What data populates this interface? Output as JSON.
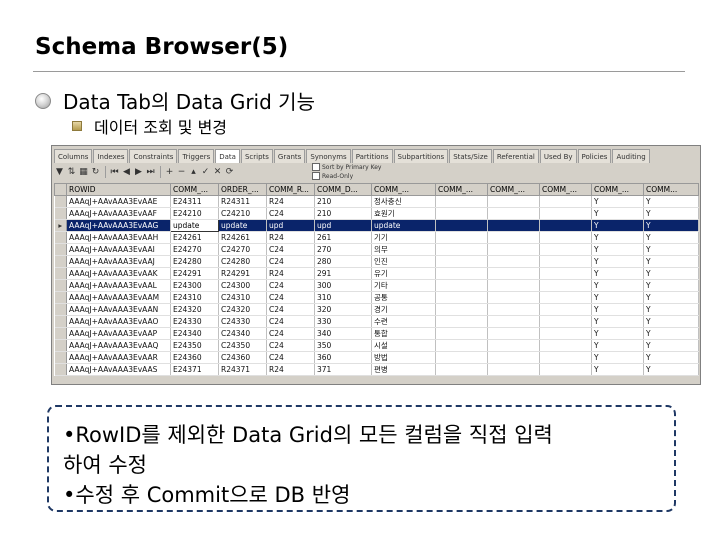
{
  "slide": {
    "title": "Schema Browser(5)",
    "bullet1": "Data Tab의 Data Grid 기능",
    "bullet2": "데이터 조회 및 변경"
  },
  "screenshot": {
    "tabs": [
      "Columns",
      "Indexes",
      "Constraints",
      "Triggers",
      "Data",
      "Scripts",
      "Grants",
      "Synonyms",
      "Partitions",
      "Subpartitions",
      "Stats/Size",
      "Referential",
      "Used By",
      "Policies",
      "Auditing"
    ],
    "active_tab": "Data",
    "toolbar_checks": [
      "Sort by Primary Key",
      "Read-Only"
    ],
    "columns": [
      "ROWID",
      "COMM_...",
      "ORDER_...",
      "COMM_R...",
      "COMM_D...",
      "COMM_...",
      "COMM_...",
      "COMM_...",
      "COMM_...",
      "COMM_...",
      "COMM..."
    ],
    "rows": [
      [
        "AAAqJ+AAvAAA3EvAAE",
        "E24311",
        "R24311",
        "R24",
        "210",
        "정사충신",
        "",
        "",
        "",
        "Y",
        "Y"
      ],
      [
        "AAAqJ+AAvAAA3EvAAF",
        "E24210",
        "C24210",
        "C24",
        "210",
        "효원기",
        "",
        "",
        "",
        "Y",
        "Y"
      ],
      [
        "AAAqJ+AAvAAA3EvAAG",
        "update",
        "update",
        "upd",
        "upd",
        "update",
        "",
        "",
        "",
        "Y",
        "Y"
      ],
      [
        "AAAqJ+AAvAAA3EvAAH",
        "E24261",
        "R24261",
        "R24",
        "261",
        "기기",
        "",
        "",
        "",
        "Y",
        "Y"
      ],
      [
        "AAAqJ+AAvAAA3EvAAI",
        "E24270",
        "C24270",
        "C24",
        "270",
        "의무",
        "",
        "",
        "",
        "Y",
        "Y"
      ],
      [
        "AAAqJ+AAvAAA3EvAAJ",
        "E24280",
        "C24280",
        "C24",
        "280",
        "인진",
        "",
        "",
        "",
        "Y",
        "Y"
      ],
      [
        "AAAqJ+AAvAAA3EvAAK",
        "E24291",
        "R24291",
        "R24",
        "291",
        "유기",
        "",
        "",
        "",
        "Y",
        "Y"
      ],
      [
        "AAAqJ+AAvAAA3EvAAL",
        "E24300",
        "C24300",
        "C24",
        "300",
        "기타",
        "",
        "",
        "",
        "Y",
        "Y"
      ],
      [
        "AAAqJ+AAvAAA3EvAAM",
        "E24310",
        "C24310",
        "C24",
        "310",
        "공통",
        "",
        "",
        "",
        "Y",
        "Y"
      ],
      [
        "AAAqJ+AAvAAA3EvAAN",
        "E24320",
        "C24320",
        "C24",
        "320",
        "경기",
        "",
        "",
        "",
        "Y",
        "Y"
      ],
      [
        "AAAqJ+AAvAAA3EvAAO",
        "E24330",
        "C24330",
        "C24",
        "330",
        "수련",
        "",
        "",
        "",
        "Y",
        "Y"
      ],
      [
        "AAAqJ+AAvAAA3EvAAP",
        "E24340",
        "C24340",
        "C24",
        "340",
        "통합",
        "",
        "",
        "",
        "Y",
        "Y"
      ],
      [
        "AAAqJ+AAvAAA3EvAAQ",
        "E24350",
        "C24350",
        "C24",
        "350",
        "시설",
        "",
        "",
        "",
        "Y",
        "Y"
      ],
      [
        "AAAqJ+AAvAAA3EvAAR",
        "E24360",
        "C24360",
        "C24",
        "360",
        "방법",
        "",
        "",
        "",
        "Y",
        "Y"
      ],
      [
        "AAAqJ+AAvAAA3EvAAS",
        "E24371",
        "R24371",
        "R24",
        "371",
        "편병",
        "",
        "",
        "",
        "Y",
        "Y"
      ]
    ]
  },
  "note": {
    "line1": "•RowID를 제외한 Data Grid의 모든 컬럼을 직접 입력",
    "line2": "하여 수정",
    "line3": "•수정 후 Commit으로 DB 반영"
  }
}
